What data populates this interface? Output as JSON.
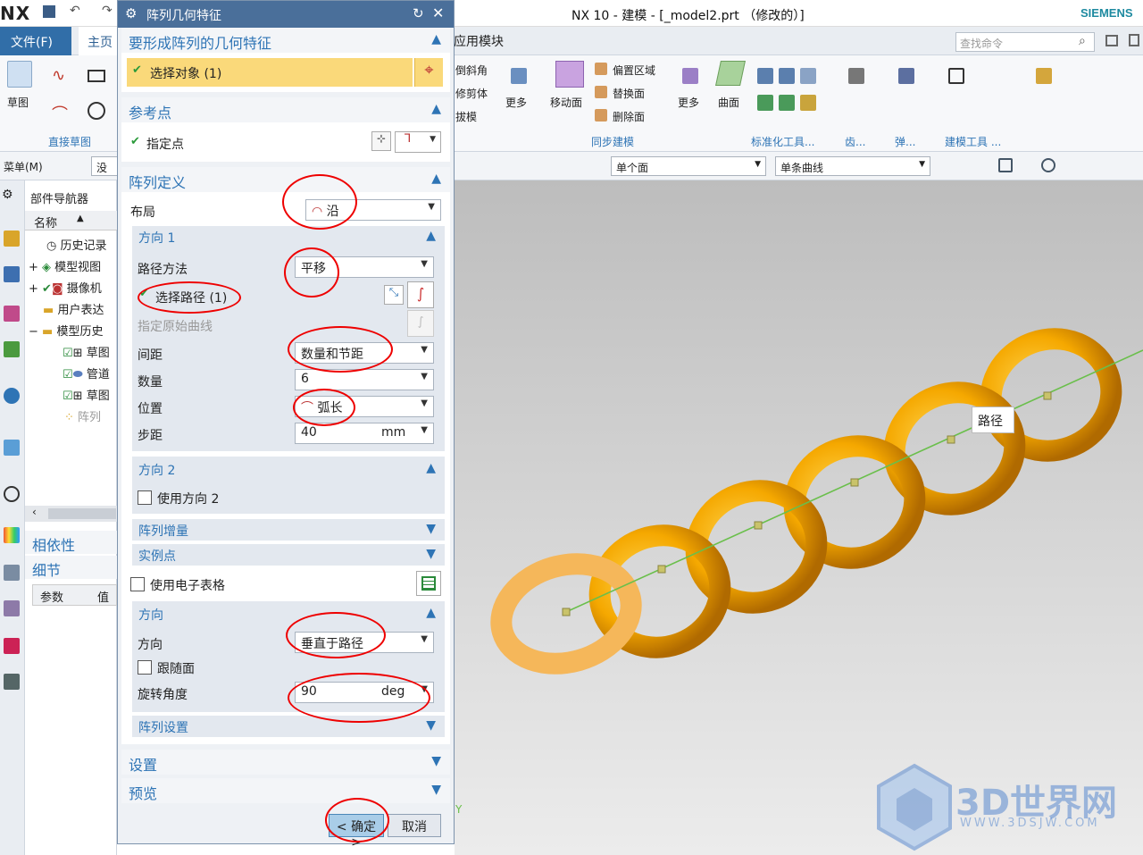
{
  "window": {
    "logo": "NX",
    "title": "NX 10 - 建模 - [_model2.prt （修改的）]",
    "brand": "SIEMENS"
  },
  "tabs": {
    "file": "文件(F)",
    "home": "主页",
    "app": "应用模块",
    "search_placeholder": "查找命令"
  },
  "ribbon": {
    "sketch": "草图",
    "direct_sketch": "直接草图",
    "chamfer": "倒斜角",
    "trim_body": "修剪体",
    "draft": "拔模",
    "more1": "更多",
    "move_face": "移动面",
    "offset_region": "偏置区域",
    "replace_face": "替换面",
    "delete_face": "删除面",
    "more2": "更多",
    "sync_modeling": "同步建模",
    "surface": "曲面",
    "std_tools": "标准化工具...",
    "gear": "齿...",
    "spring": "弹...",
    "build_tools": "建模工具 ..."
  },
  "toolbar2": {
    "menu": "菜单(M)",
    "filter": "没有",
    "face_rule": "单个面",
    "curve_rule": "单条曲线"
  },
  "navigator": {
    "title": "部件导航器",
    "col_name": "名称",
    "items": [
      "历史记录",
      "模型视图",
      "摄像机",
      "用户表达",
      "模型历史",
      "草图",
      "管道",
      "草图",
      "阵列"
    ],
    "dependency": "相依性",
    "details": "细节",
    "col_param": "参数",
    "col_value": "值"
  },
  "dialog": {
    "title": "阵列几何特征",
    "geom_section": "要形成阵列的几何特征",
    "select_object": "选择对象 (1)",
    "ref_section": "参考点",
    "specify_point": "指定点",
    "def_section": "阵列定义",
    "layout_label": "布局",
    "layout_value": "沿",
    "dir1": "方向 1",
    "path_method_label": "路径方法",
    "path_method_value": "平移",
    "select_path": "选择路径 (1)",
    "orig_curve": "指定原始曲线",
    "spacing_label": "间距",
    "spacing_value": "数量和节距",
    "count_label": "数量",
    "count_value": "6",
    "position_label": "位置",
    "position_value": "弧长",
    "step_label": "步距",
    "step_value": "40",
    "step_unit": "mm",
    "dir2": "方向 2",
    "use_dir2": "使用方向 2",
    "increment": "阵列增量",
    "instance_pt": "实例点",
    "use_sheet": "使用电子表格",
    "orient_section": "方向",
    "orient_label": "方向",
    "orient_value": "垂直于路径",
    "follow_face": "跟随面",
    "rot_label": "旋转角度",
    "rot_value": "90",
    "rot_unit": "deg",
    "pattern_settings": "阵列设置",
    "settings": "设置",
    "preview": "预览",
    "ok": "< 确定 >",
    "cancel": "取消"
  },
  "viewport": {
    "tooltip": "路径",
    "axis_y": "Y",
    "watermark": "3D世界网",
    "watermark_url": "WWW.3DSJW.COM"
  },
  "colors": {
    "accent": "#2e74b5",
    "title_bar": "#4a6f9a",
    "ring": "#f5a800",
    "path": "#6abf4b"
  }
}
